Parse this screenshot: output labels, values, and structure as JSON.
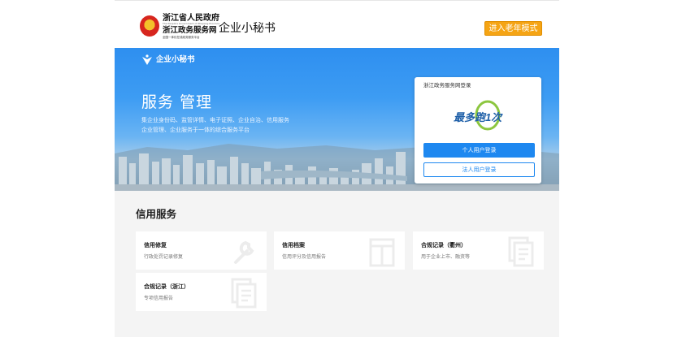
{
  "header": {
    "gov_title": "浙江省人民政府",
    "gov_en": "The People's Government of Zhejiang Province",
    "gov_net": "浙江政务服务网",
    "gov_tagline": "全国一体化在线政务服务平台",
    "app_title": "企业小秘书",
    "elder_mode_label": "进入老年模式"
  },
  "banner": {
    "logo_text": "企业小秘书",
    "headline": "服务 管理",
    "desc_line1": "集企业身份码、监管详情、电子证照、企业自治、信用服务",
    "desc_line2": "企业管理、企业服务于一体的综合服务平台"
  },
  "login": {
    "title": "浙江政务服务网登录",
    "logo_text": "最多跑1次",
    "personal_label": "个人用户登录",
    "corporate_label": "法人用户登录"
  },
  "services": {
    "title": "信用服务",
    "cards": [
      {
        "title": "信用修复",
        "desc": "行政处罚记录修复",
        "icon": "wrench-icon"
      },
      {
        "title": "信用档案",
        "desc": "信用评分及信用报告",
        "icon": "archive-icon"
      },
      {
        "title": "合规记录（衢州）",
        "desc": "用于企业上市、融资等",
        "icon": "document-icon"
      },
      {
        "title": "合规记录（浙江）",
        "desc": "专项信用报告",
        "icon": "document-icon"
      }
    ]
  },
  "colors": {
    "accent": "#1e88f0",
    "elder_button": "#f5a414",
    "banner_top": "#2e8ff0",
    "services_bg": "#f4f4f4"
  }
}
